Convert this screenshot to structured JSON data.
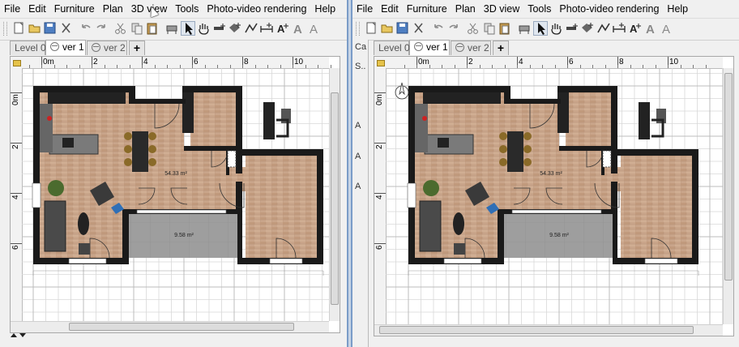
{
  "menu": [
    "File",
    "Edit",
    "Furniture",
    "Plan",
    "3D view",
    "Tools",
    "Photo-video rendering",
    "Help"
  ],
  "toolbar": {
    "icons": [
      "new-file-icon",
      "open-icon",
      "save-icon",
      "cut-tool-icon",
      "undo-icon",
      "redo-icon",
      "cut-icon",
      "copy-icon",
      "paste-icon",
      "add-furniture-icon",
      "select-icon",
      "pan-icon",
      "create-walls-icon",
      "create-rooms-icon",
      "create-polylines-icon",
      "create-dimensions-icon",
      "add-text-icon",
      "text-style-icon",
      "zoom-icon"
    ]
  },
  "left_window": {
    "tabs": [
      "Level 0",
      "ver 1",
      "ver 2"
    ],
    "selected_tab": "ver 1",
    "ruler_top": [
      "0m",
      "2",
      "4",
      "6",
      "8",
      "10"
    ],
    "ruler_left": [
      "0m",
      "2",
      "4",
      "6"
    ],
    "rooms": [
      {
        "area": "54.33 m²"
      },
      {
        "area": "9.58 m²"
      }
    ]
  },
  "right_window": {
    "side_labels": [
      "Ca",
      "S..",
      "A",
      "A",
      "A"
    ],
    "tabs": [
      "Level 0",
      "ver 1",
      "ver 2"
    ],
    "selected_tab": "ver 1",
    "ruler_top": [
      "0m",
      "2",
      "4",
      "6",
      "8",
      "10"
    ],
    "ruler_left": [
      "0m",
      "2",
      "4",
      "6"
    ],
    "rooms": [
      {
        "area": "54.33 m²"
      },
      {
        "area": "9.58 m²"
      }
    ]
  },
  "colors": {
    "wall": "#1a1a1a",
    "wood_floor": "#c9a58a",
    "terrace": "#9e9e9e",
    "grid": "#d8d8d8",
    "window_frame": "#7a9cc8"
  }
}
